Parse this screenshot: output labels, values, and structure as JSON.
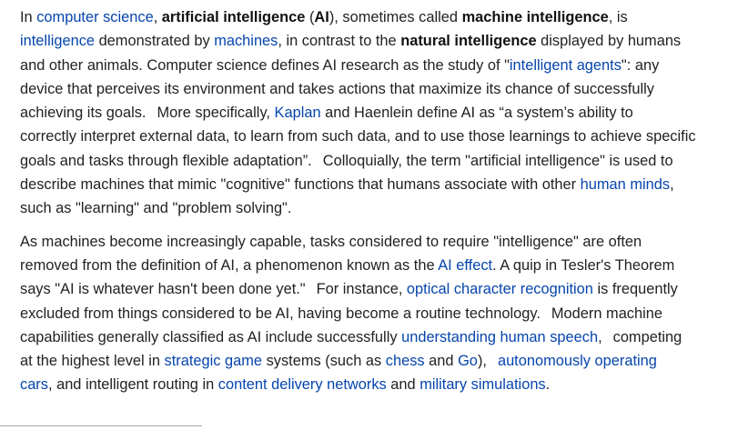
{
  "colors": {
    "link": "#0645ad",
    "text": "#222222",
    "background": "#ffffff"
  },
  "p1": {
    "l1a": "In ",
    "l1b": "computer science",
    "l1c": ", ",
    "l1d": "artificial intelligence",
    "l1e": " (",
    "l1f": "AI",
    "l1g": "), sometimes called ",
    "l1h": "machine intelligence",
    "l1i": ", is",
    "l2a": "intelligence",
    "l2b": " demonstrated by ",
    "l2c": "machines",
    "l2d": ", in contrast to the ",
    "l2e": "natural intelligence",
    "l2f": " displayed by humans",
    "l3a": "and other animals. Computer science defines AI research as the study of \"",
    "l3b": "intelligent agents",
    "l3c": "\": any",
    "l4a": "device that perceives its environment and takes actions that maximize its chance of successfully",
    "l5a": "achieving its goals.",
    "l5b": "More specifically, ",
    "l5c": "Kaplan",
    "l5d": " and Haenlein define AI as “a system’s ability to",
    "l6a": "correctly interpret external data, to learn from such data, and to use those learnings to achieve specific",
    "l7a": "goals and tasks through flexible adaptation”.",
    "l7b": "Colloquially, the term \"artificial intelligence\" is used to",
    "l8a": "describe machines that mimic \"cognitive\" functions that humans associate with other ",
    "l8b": "human minds",
    "l8c": ",",
    "l9a": "such as \"learning\" and \"problem solving\"."
  },
  "p2": {
    "l1a": "As machines become increasingly capable, tasks considered to require \"intelligence\" are often",
    "l2a": "removed from the definition of AI, a phenomenon known as the ",
    "l2b": "AI effect",
    "l2c": ". A quip in Tesler's Theorem",
    "l3a": "says \"AI is whatever hasn't been done yet.\"",
    "l3b": "For instance, ",
    "l3c": "optical character recognition",
    "l3d": " is frequently",
    "l4a": "excluded from things considered to be AI, having become a routine technology.",
    "l4b": "Modern machine",
    "l5a": "capabilities generally classified as AI include successfully ",
    "l5b": "understanding human speech",
    "l5c": ",",
    "l5d": "competing",
    "l6a": "at the highest level in ",
    "l6b": "strategic game",
    "l6c": " systems (such as ",
    "l6d": "chess",
    "l6e": " and ",
    "l6f": "Go",
    "l6g": "),",
    "l6h": "autonomously operating",
    "l7a": "cars",
    "l7b": ", and intelligent routing in ",
    "l7c": "content delivery networks",
    "l7d": " and ",
    "l7e": "military simulations",
    "l7f": "."
  }
}
